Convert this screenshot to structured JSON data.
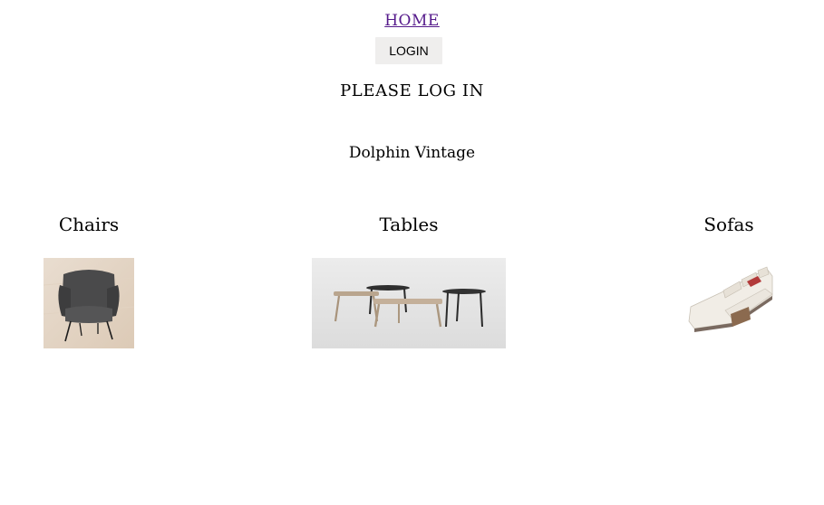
{
  "nav": {
    "home_label": "HOME",
    "login_label": "LOGIN"
  },
  "main": {
    "login_prompt": "PLEASE LOG IN",
    "brand_name": "Dolphin Vintage"
  },
  "categories": [
    {
      "label": "Chairs",
      "image_icon": "armchair-image"
    },
    {
      "label": "Tables",
      "image_icon": "tables-image"
    },
    {
      "label": "Sofas",
      "image_icon": "sofa-image"
    }
  ],
  "colors": {
    "link_visited": "#551a8b",
    "button_bg": "#efeeed",
    "text": "#000000",
    "background": "#ffffff"
  }
}
